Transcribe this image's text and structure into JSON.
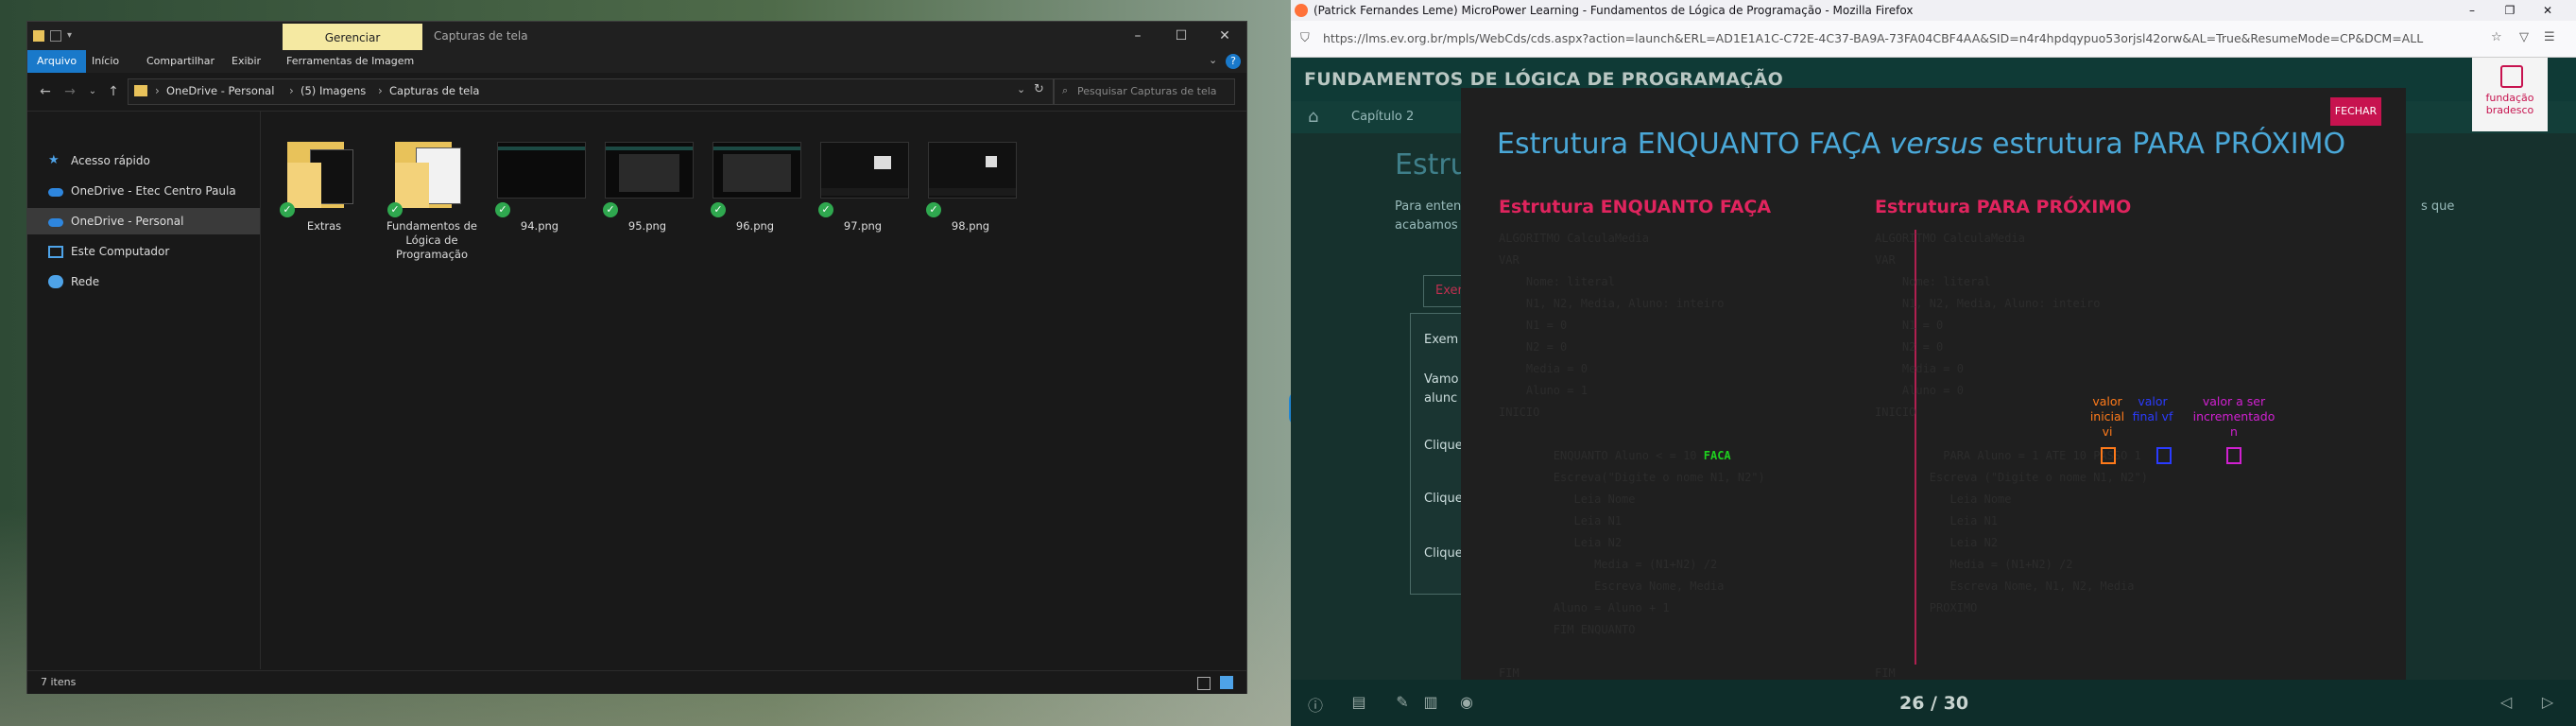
{
  "explorer": {
    "ribbon_manage": "Gerenciar",
    "window_title": "Capturas de tela",
    "tabs": [
      "Arquivo",
      "Início",
      "Compartilhar",
      "Exibir",
      "Ferramentas de Imagem"
    ],
    "breadcrumb": [
      "OneDrive - Personal",
      "(5) Imagens",
      "Capturas de tela"
    ],
    "search_placeholder": "Pesquisar Capturas de tela",
    "nav_items": [
      "Acesso rápido",
      "OneDrive - Etec Centro Paula Souza",
      "OneDrive - Personal",
      "Este Computador",
      "Rede"
    ],
    "files": [
      {
        "name": "Extras",
        "type": "folder"
      },
      {
        "name": "Fundamentos de Lógica de Programação",
        "type": "folder"
      },
      {
        "name": "94.png",
        "type": "image"
      },
      {
        "name": "95.png",
        "type": "image"
      },
      {
        "name": "96.png",
        "type": "image"
      },
      {
        "name": "97.png",
        "type": "image"
      },
      {
        "name": "98.png",
        "type": "image"
      }
    ],
    "status": "7 itens",
    "colors": {
      "accent": "#1979ca",
      "manage_tab": "#f5e9a2",
      "sync_ok": "#2fa84f"
    }
  },
  "firefox": {
    "window_title": "(Patrick Fernandes Leme) MicroPower Learning - Fundamentos de Lógica de Programação - Mozilla Firefox",
    "url": "https://lms.ev.org.br/mpls/WebCds/cds.aspx?action=launch&ERL=AD1E1A1C-C72E-4C37-BA9A-73FA04CBF4AA&SID=n4r4hpdqypuo53orjsl42orw&AL=True&ResumeMode=CP&DCM=ALL",
    "course_title": "FUNDAMENTOS DE LÓGICA DE PROGRAMAÇÃO",
    "chapter": "Capítulo 2",
    "bg_heading": "Estrutu",
    "bg_text_1": "Para enten",
    "bg_text_2": "acabamos",
    "bg_text_right": "s que",
    "bg_tab": "Exer",
    "bg_items": [
      "Exem",
      "Vamo",
      "alunc",
      "Clique",
      "Clique",
      "Clique"
    ],
    "logo_text": "fundação bradesco",
    "slide_counter": "26 / 30"
  },
  "modal": {
    "title_pre": "Estrutura ENQUANTO FAÇA ",
    "title_em": "versus",
    "title_post": " estrutura PARA PRÓXIMO",
    "close_label": "FECHAR",
    "left": {
      "title": "Estrutura ENQUANTO FAÇA",
      "code": [
        "ALGORITMO CalculaMedia",
        "VAR",
        "    Nome: literal",
        "    N1, N2, Media, Aluno: inteiro",
        "    N1 = 0",
        "    N2 = 0",
        "    Media = 0",
        "    Aluno = 1",
        "INICIO",
        "",
        "        ENQUANTO Aluno < = 10 FACA",
        "        Escreva(\"Digite o nome N1, N2\")",
        "           Leia Nome",
        "           Leia N1",
        "           Leia N2",
        "              Media = (N1+N2) /2",
        "              Escreva Nome, Media",
        "        Aluno = Aluno + 1",
        "        FIM ENQUANTO",
        "",
        "FIM"
      ],
      "keyword_highlight": "FACA"
    },
    "right": {
      "title": "Estrutura PARA PRÓXIMO",
      "code": [
        "ALGORITMO CalculaMedia",
        "VAR",
        "    Nome: literal",
        "    N1, N2, Media, Aluno: inteiro",
        "    N1 = 0",
        "    N2 = 0",
        "    Media = 0",
        "    Aluno = 0",
        "INICIO",
        "",
        "          PARA Aluno = 1 ATE 10 PASSO 1",
        "        Escreva (\"Digite o nome N1, N2\")",
        "           Leia Nome",
        "           Leia N1",
        "           Leia N2",
        "           Media = (N1+N2) /2",
        "           Escreva Nome, N1, N2, Media",
        "        PROXIMO",
        "",
        "",
        "FIM"
      ],
      "annotations": [
        {
          "label": "valor inicial vi",
          "color": "#ff7a1a"
        },
        {
          "label": "valor final vf",
          "color": "#2a3bff"
        },
        {
          "label": "valor a ser incrementado n",
          "color": "#d020d0"
        }
      ]
    },
    "colors": {
      "title": "#4aa8d8",
      "section_title": "#e0245e",
      "close_bg": "#c7134f",
      "keyword": "#1fd01f"
    }
  }
}
